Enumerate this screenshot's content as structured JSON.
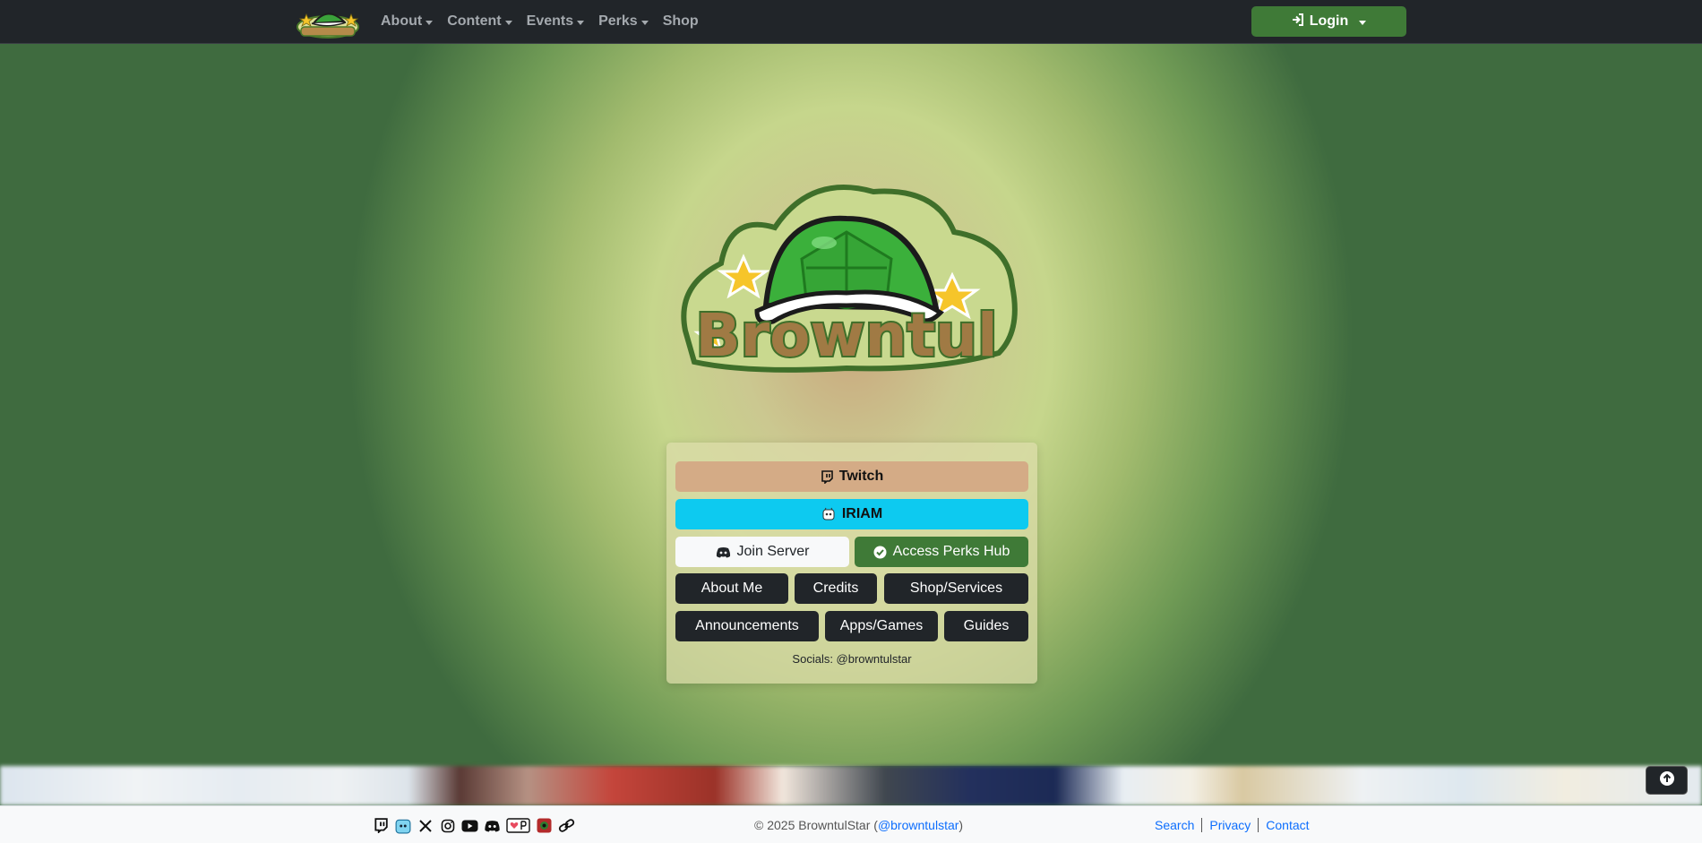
{
  "navbar": {
    "menu": [
      {
        "label": "About",
        "has_dropdown": true
      },
      {
        "label": "Content",
        "has_dropdown": true
      },
      {
        "label": "Events",
        "has_dropdown": true
      },
      {
        "label": "Perks",
        "has_dropdown": true
      },
      {
        "label": "Shop",
        "has_dropdown": false
      }
    ],
    "login_label": "Login"
  },
  "hero": {
    "logo_text": "Browntul",
    "buttons": {
      "twitch": "Twitch",
      "iriam": "IRIAM",
      "join_server": "Join Server",
      "access_perks": "Access Perks Hub",
      "about_me": "About Me",
      "credits": "Credits",
      "shop_services": "Shop/Services",
      "announcements": "Announcements",
      "apps_games": "Apps/Games",
      "guides": "Guides"
    },
    "socials_text": "Socials: @browntulstar"
  },
  "footer": {
    "social_icons": [
      "twitch-icon",
      "iriam-icon",
      "x-icon",
      "instagram-icon",
      "youtube-icon",
      "discord-icon",
      "kofi-icon",
      "app-icon",
      "link-icon"
    ],
    "copyright_prefix": "© 2025 BrowntulStar (",
    "copyright_handle": "@browntulstar",
    "copyright_suffix": ")",
    "links": [
      "Search",
      "Privacy",
      "Contact"
    ]
  },
  "colors": {
    "navbar_bg": "#212529",
    "accent_green": "#3f7a37",
    "twitch_tan": "#d4ab86",
    "iriam_cyan": "#0dcaf0",
    "link_blue": "#0d6efd"
  }
}
